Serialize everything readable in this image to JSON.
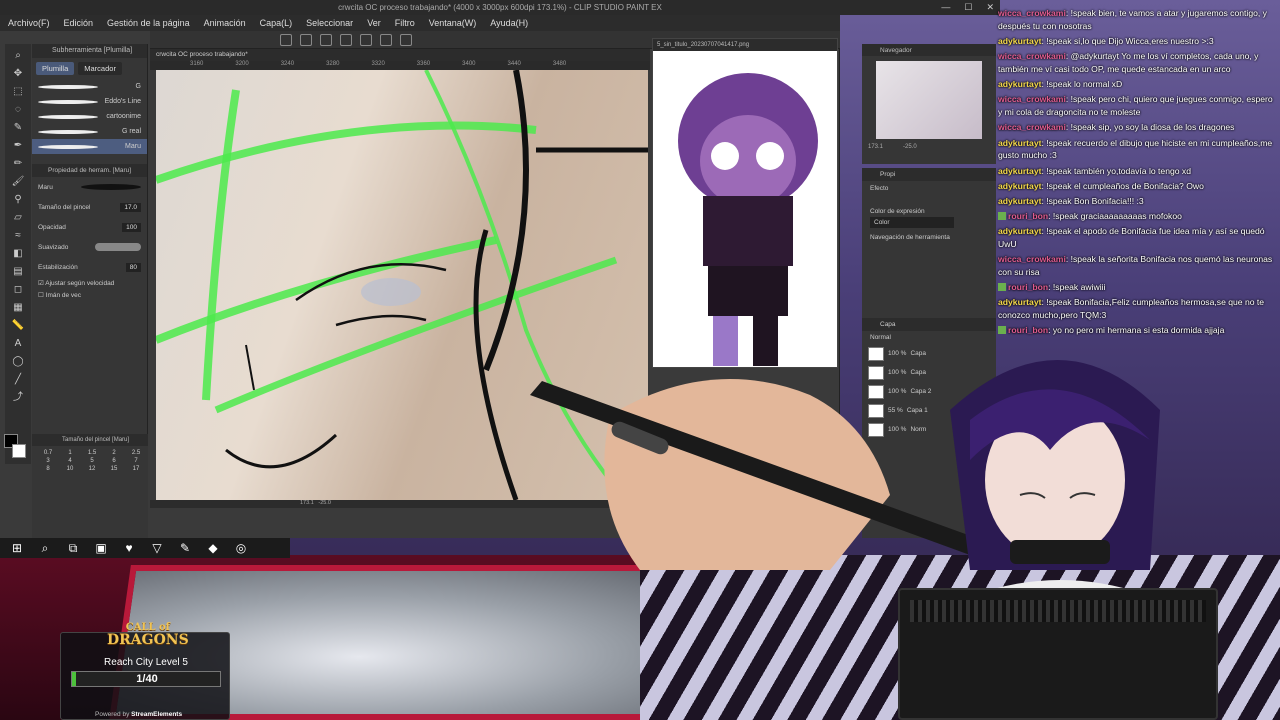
{
  "window": {
    "title": "crwcita OC proceso trabajando* (4000 x 3000px 600dpi 173.1%) - CLIP STUDIO PAINT EX"
  },
  "menu": [
    "Archivo(F)",
    "Edición",
    "Gestión de la página",
    "Animación",
    "Capa(L)",
    "Seleccionar",
    "Ver",
    "Filtro",
    "Ventana(W)",
    "Ayuda(H)"
  ],
  "subtool": {
    "header": "Subherramienta [Plumilla]",
    "tabs": [
      "Plumilla",
      "Marcador"
    ],
    "brushes": [
      "G",
      "Eddo's Line",
      "cartoonime",
      "G real",
      "Maru"
    ],
    "selected_brush": "Maru"
  },
  "tool_property": {
    "header": "Propiedad de herram. [Maru]",
    "brush_name": "Maru",
    "size_label": "Tamaño del pincel",
    "size_value": "17.0",
    "opacity_label": "Opacidad",
    "opacity_value": "100",
    "smoothing_label": "Suavizado",
    "stabilization_label": "Estabilización",
    "stabilization_value": "80",
    "adjust_speed_label": "Ajustar según velocidad",
    "vector_label": "Imán de vec"
  },
  "brush_size": {
    "header": "Tamaño del pincel [Maru]",
    "sizes": [
      "0.7",
      "1",
      "1.5",
      "2",
      "2.5",
      "3",
      "4",
      "5",
      "6",
      "7",
      "8",
      "10",
      "12",
      "15",
      "17"
    ]
  },
  "canvas": {
    "tab": "crwcita OC proceso trabajando*",
    "ruler": [
      "3160",
      "3200",
      "3240",
      "3280",
      "3320",
      "3360",
      "3400",
      "3440",
      "3480"
    ],
    "zoom": "173.1",
    "rotation": "-25.0"
  },
  "reference": {
    "tab": "5_sin_titulo_20230707041417.png"
  },
  "navigator": {
    "header": "Navegador",
    "zoom": "173.1",
    "rotation": "-25.0"
  },
  "property_panel": {
    "header": "Propi",
    "effect_label": "Efecto",
    "expression_label": "Color de expresión",
    "expression_value": "Color",
    "tool_nav_label": "Navegación de herramienta"
  },
  "layer_panel": {
    "header": "Capa",
    "blend": "Normal",
    "layers": [
      {
        "opacity": "100 %",
        "name": "Capa"
      },
      {
        "opacity": "100 %",
        "name": "Capa"
      },
      {
        "opacity": "100 %",
        "name": "Capa 2"
      },
      {
        "opacity": "55 %",
        "name": "Capa 1"
      },
      {
        "opacity": "100 %",
        "name": "Norm"
      }
    ]
  },
  "chat": [
    {
      "user": "wicca_crowkami",
      "color": "pink",
      "msg": ": !speak bien, te vamos a atar y jugaremos contigo, y después tu con nosotras"
    },
    {
      "user": "adykurtayt",
      "color": "yellow",
      "msg": ": !speak si,lo que Dijo Wicca,eres nuestro >:3"
    },
    {
      "user": "wicca_crowkami",
      "color": "pink",
      "msg": ": @adykurtayt Yo me los ví completos, cada uno, y también me ví casi todo OP, me quede estancada en un arco"
    },
    {
      "user": "adykurtayt",
      "color": "yellow",
      "msg": ": !speak lo normal xD"
    },
    {
      "user": "wicca_crowkami",
      "color": "pink",
      "msg": ": !speak pero chi, quiero que juegues conmigo, espero y mi cola de dragoncita no te moleste"
    },
    {
      "user": "wicca_crowkami",
      "color": "pink",
      "msg": ": !speak sip, yo soy la diosa de los dragones"
    },
    {
      "user": "adykurtayt",
      "color": "yellow",
      "msg": ": !speak recuerdo el dibujo que hiciste en mi cumpleaños,me gusto mucho :3"
    },
    {
      "user": "adykurtayt",
      "color": "yellow",
      "msg": ": !speak también yo,todavía lo tengo xd"
    },
    {
      "user": "adykurtayt",
      "color": "yellow",
      "msg": ": !speak el cumpleaños de Bonifacia? Owo"
    },
    {
      "user": "adykurtayt",
      "color": "yellow",
      "msg": ": !speak Bon Bonifacia!!! :3"
    },
    {
      "user": "rouri_bon",
      "color": "pink",
      "badge": true,
      "msg": ": !speak graciaaaaaaaaas mofokoo"
    },
    {
      "user": "adykurtayt",
      "color": "yellow",
      "msg": ": !speak el apodo de Bonifacia fue idea mía y así se quedó UwU"
    },
    {
      "user": "wicca_crowkami",
      "color": "pink",
      "msg": ": !speak la señorita Bonifacia nos quemó las neuronas con su risa"
    },
    {
      "user": "rouri_bon",
      "color": "pink",
      "badge": true,
      "msg": ": !speak awiwiii"
    },
    {
      "user": "adykurtayt",
      "color": "yellow",
      "msg": ": !speak Bonifacia,Feliz cumpleaños hermosa,se que no te conozco mucho,pero TQM:3"
    },
    {
      "user": "rouri_bon",
      "color": "pink",
      "badge": true,
      "msg": ": yo no pero mi hermana si esta dormida ajjaja"
    }
  ],
  "widget": {
    "logo_line1": "CALL of",
    "logo_line2": "DRAGONS",
    "title": "Reach City Level 5",
    "progress": "1/40",
    "progress_fraction": 0.025,
    "powered": "Powered by",
    "powered_brand": "StreamElements"
  },
  "colors": {
    "accent_green": "#4cc23b",
    "chat_yellow": "#f4d84a",
    "chat_pink": "#e05b8f",
    "csp_dark": "#363636"
  }
}
